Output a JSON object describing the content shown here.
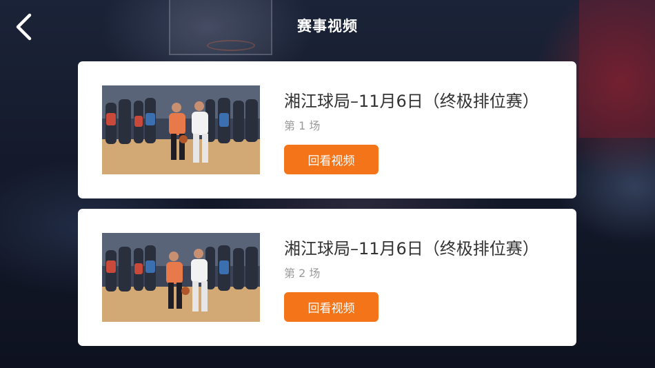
{
  "header": {
    "title": "赛事视频",
    "back_icon": "chevron-left-icon"
  },
  "matches": [
    {
      "title": "湘江球局–11月6日（终极排位赛）",
      "round": "第 1 场",
      "button_label": "回看视频",
      "thumbnail": "basketball-game-photo"
    },
    {
      "title": "湘江球局–11月6日（终极排位赛）",
      "round": "第 2 场",
      "button_label": "回看视频",
      "thumbnail": "basketball-game-photo"
    }
  ],
  "colors": {
    "accent": "#f47419",
    "card_bg": "#ffffff",
    "title_text": "#333333",
    "sub_text": "#9a9a9a"
  }
}
